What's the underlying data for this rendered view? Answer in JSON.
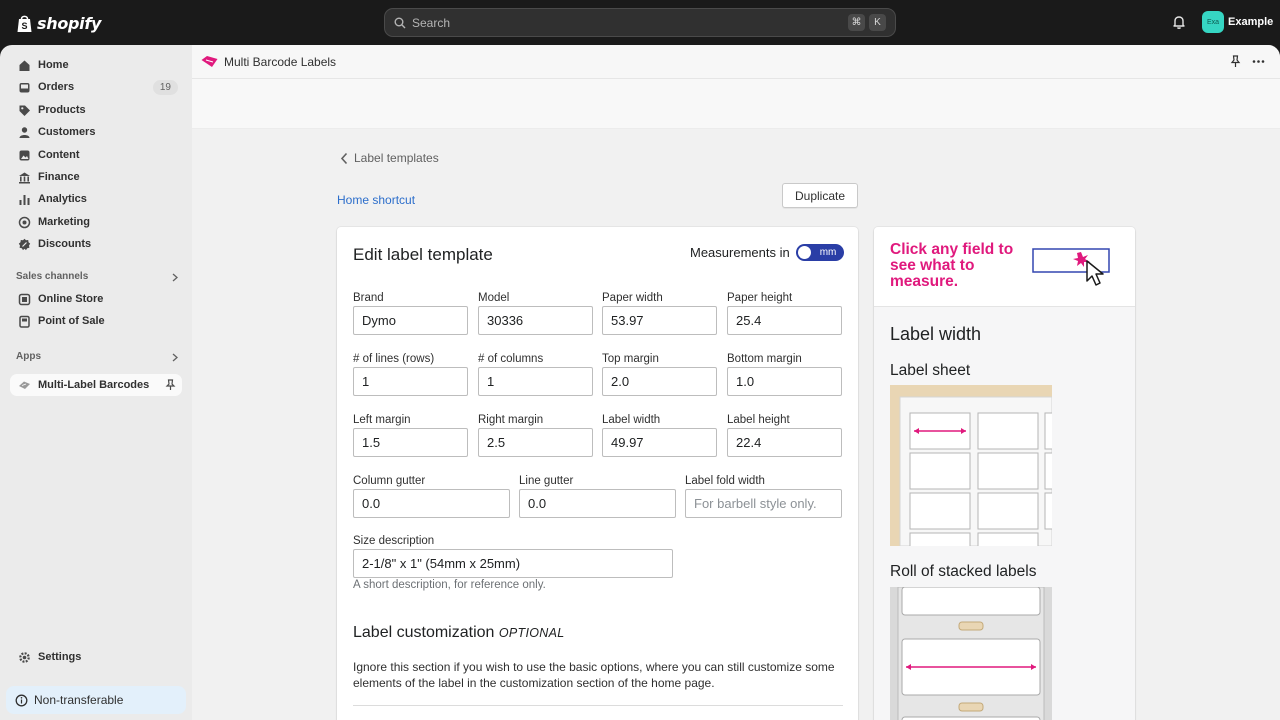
{
  "topbar": {
    "brand": "shopify",
    "search_placeholder": "Search",
    "shortcut_keys": [
      "⌘",
      "K"
    ],
    "store_initials": "Exa",
    "store_name": "Example"
  },
  "sidebar": {
    "items": [
      {
        "label": "Home",
        "icon": "home-icon"
      },
      {
        "label": "Orders",
        "icon": "inbox-icon",
        "badge": "19"
      },
      {
        "label": "Products",
        "icon": "tag-icon"
      },
      {
        "label": "Customers",
        "icon": "person-icon"
      },
      {
        "label": "Content",
        "icon": "content-icon"
      },
      {
        "label": "Finance",
        "icon": "bank-icon"
      },
      {
        "label": "Analytics",
        "icon": "bar-chart-icon"
      },
      {
        "label": "Marketing",
        "icon": "target-icon"
      },
      {
        "label": "Discounts",
        "icon": "discount-icon"
      }
    ],
    "sales_channels_title": "Sales channels",
    "sales_channels": [
      {
        "label": "Online Store",
        "icon": "store-icon"
      },
      {
        "label": "Point of Sale",
        "icon": "pos-icon"
      }
    ],
    "apps_title": "Apps",
    "apps": [
      {
        "label": "Multi-Label Barcodes",
        "icon": "app-icon"
      }
    ],
    "settings_label": "Settings",
    "notice": "Non-transferable"
  },
  "appbar": {
    "title": "Multi Barcode Labels"
  },
  "page": {
    "back_label": "Label templates",
    "home_shortcut": "Home shortcut",
    "duplicate_label": "Duplicate"
  },
  "form": {
    "title": "Edit label template",
    "measurements_label": "Measurements in",
    "unit": "mm",
    "fields": {
      "brand": {
        "label": "Brand",
        "value": "Dymo"
      },
      "model": {
        "label": "Model",
        "value": "30336"
      },
      "paper_width": {
        "label": "Paper width",
        "value": "53.97"
      },
      "paper_height": {
        "label": "Paper height",
        "value": "25.4"
      },
      "lines": {
        "label": "# of lines (rows)",
        "value": "1"
      },
      "columns": {
        "label": "# of columns",
        "value": "1"
      },
      "top_margin": {
        "label": "Top margin",
        "value": "2.0"
      },
      "bottom_margin": {
        "label": "Bottom margin",
        "value": "1.0"
      },
      "left_margin": {
        "label": "Left margin",
        "value": "1.5"
      },
      "right_margin": {
        "label": "Right margin",
        "value": "2.5"
      },
      "label_width": {
        "label": "Label width",
        "value": "49.97"
      },
      "label_height": {
        "label": "Label height",
        "value": "22.4"
      },
      "column_gutter": {
        "label": "Column gutter",
        "value": "0.0"
      },
      "line_gutter": {
        "label": "Line gutter",
        "value": "0.0"
      },
      "fold_width": {
        "label": "Label fold width",
        "value": "",
        "placeholder": "For barbell style only."
      },
      "size_description": {
        "label": "Size description",
        "value": "2-1/8\" x 1\" (54mm x 25mm)",
        "help": "A short description, for reference only."
      }
    },
    "customization": {
      "title": "Label customization",
      "optional": "OPTIONAL",
      "text": "Ignore this section if you wish to use the basic options, where you can still customize some elements of the label in the customization section of the home page."
    }
  },
  "side_panel": {
    "hint": "Click any field to see what to measure.",
    "heading": "Label width",
    "sheet_title": "Label sheet",
    "roll_title": "Roll of stacked labels",
    "accent_color": "#e0197d"
  }
}
